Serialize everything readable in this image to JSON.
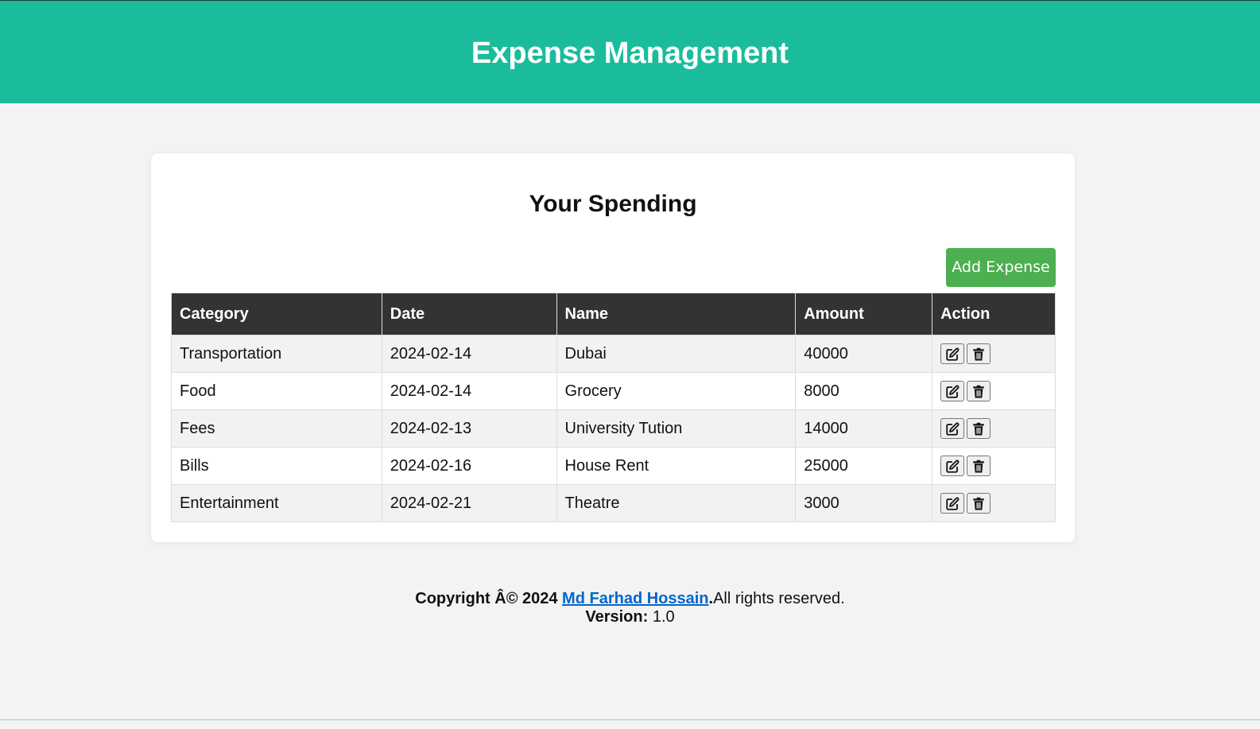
{
  "header": {
    "title": "Expense Management",
    "background_color": "#1abc9c"
  },
  "card": {
    "title": "Your Spending",
    "add_button_label": "Add Expense",
    "add_button_color": "#4caf50"
  },
  "table": {
    "columns": [
      "Category",
      "Date",
      "Name",
      "Amount",
      "Action"
    ],
    "rows": [
      {
        "category": "Transportation",
        "date": "2024-02-14",
        "name": "Dubai",
        "amount": "40000"
      },
      {
        "category": "Food",
        "date": "2024-02-14",
        "name": "Grocery",
        "amount": "8000"
      },
      {
        "category": "Fees",
        "date": "2024-02-13",
        "name": "University Tution",
        "amount": "14000"
      },
      {
        "category": "Bills",
        "date": "2024-02-16",
        "name": "House Rent",
        "amount": "25000"
      },
      {
        "category": "Entertainment",
        "date": "2024-02-21",
        "name": "Theatre",
        "amount": "3000"
      }
    ],
    "action_icons": [
      "edit-icon",
      "trash-icon"
    ]
  },
  "footer": {
    "copyright_prefix": "Copyright Â© 2024 ",
    "author_link": "Md Farhad Hossain",
    "period": ".",
    "rights": "All rights reserved.",
    "version_label": "Version:",
    "version_value": " 1.0"
  }
}
